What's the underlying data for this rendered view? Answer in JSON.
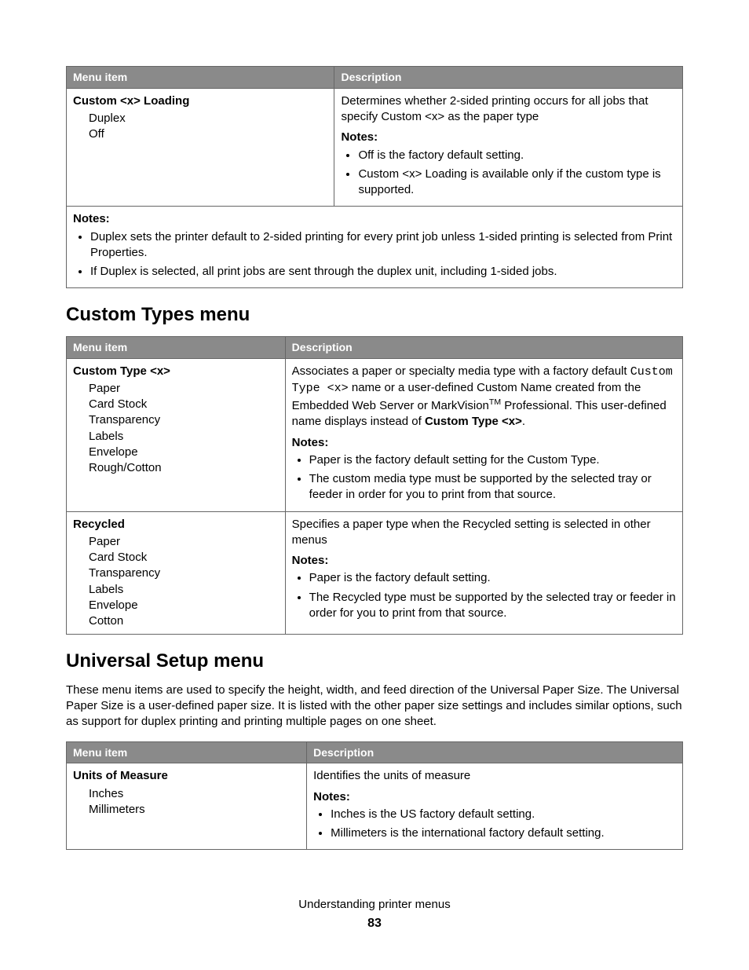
{
  "table1": {
    "headers": {
      "menu": "Menu item",
      "desc": "Description"
    },
    "row": {
      "title": "Custom <x> Loading",
      "options": [
        "Duplex",
        "Off"
      ],
      "desc": "Determines whether 2-sided printing occurs for all jobs that specify Custom <x> as the paper type",
      "notes_label": "Notes:",
      "notes": [
        "Off is the factory default setting.",
        "Custom <x> Loading is available only if the custom type is supported."
      ]
    },
    "footnotes_label": "Notes:",
    "footnotes": [
      "Duplex sets the printer default to 2-sided printing for every print job unless 1-sided printing is selected from Print Properties.",
      "If Duplex is selected, all print jobs are sent through the duplex unit, including 1-sided jobs."
    ]
  },
  "section1": {
    "heading": "Custom Types menu"
  },
  "table2": {
    "headers": {
      "menu": "Menu item",
      "desc": "Description"
    },
    "row1": {
      "title": "Custom Type <x>",
      "options": [
        "Paper",
        "Card Stock",
        "Transparency",
        "Labels",
        "Envelope",
        "Rough/Cotton"
      ],
      "desc_pre": "Associates a paper or specialty media type with a factory default ",
      "desc_mono": "Custom Type <x>",
      "desc_mid": " name or a user-defined Custom Name created from the Embedded Web Server or MarkVision",
      "desc_tm": "TM",
      "desc_post1": " Professional. This user-defined name displays instead of ",
      "desc_bold": "Custom Type <x>",
      "desc_post2": ".",
      "notes_label": "Notes:",
      "notes": [
        "Paper is the factory default setting for the Custom Type.",
        "The custom media type must be supported by the selected tray or feeder in order for you to print from that source."
      ]
    },
    "row2": {
      "title": "Recycled",
      "options": [
        "Paper",
        "Card Stock",
        "Transparency",
        "Labels",
        "Envelope",
        "Cotton"
      ],
      "desc": "Specifies a paper type when the Recycled setting is selected in other menus",
      "notes_label": "Notes:",
      "notes": [
        "Paper is the factory default setting.",
        "The Recycled type must be supported by the selected tray or feeder in order for you to print from that source."
      ]
    }
  },
  "section2": {
    "heading": "Universal Setup menu",
    "intro": "These menu items are used to specify the height, width, and feed direction of the Universal Paper Size. The Universal Paper Size is a user-defined paper size. It is listed with the other paper size settings and includes similar options, such as support for duplex printing and printing multiple pages on one sheet."
  },
  "table3": {
    "headers": {
      "menu": "Menu item",
      "desc": "Description"
    },
    "row": {
      "title": "Units of Measure",
      "options": [
        "Inches",
        "Millimeters"
      ],
      "desc": "Identifies the units of measure",
      "notes_label": "Notes:",
      "notes": [
        "Inches is the US factory default setting.",
        "Millimeters is the international factory default setting."
      ]
    }
  },
  "footer": {
    "section": "Understanding printer menus",
    "page": "83"
  }
}
